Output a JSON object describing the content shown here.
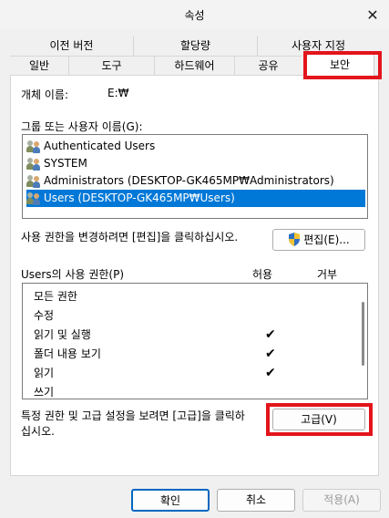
{
  "window": {
    "title": "속성",
    "close_glyph": "✕"
  },
  "tabs": {
    "row1": [
      "이전 버전",
      "할당량",
      "사용자 지정"
    ],
    "row2": [
      "일반",
      "도구",
      "하드웨어",
      "공유",
      "보안"
    ]
  },
  "object_name": {
    "label": "개체 이름:",
    "value": "E:₩"
  },
  "groups": {
    "label": "그룹 또는 사용자 이름(G):",
    "items": [
      "Authenticated Users",
      "SYSTEM",
      "Administrators (DESKTOP-GK465MP₩Administrators)",
      "Users (DESKTOP-GK465MP₩Users)"
    ],
    "selected_index": 3
  },
  "edit": {
    "hint": "사용 권한을 변경하려면 [편집]을 클릭하십시오.",
    "button": "편집(E)..."
  },
  "permissions": {
    "label": "Users의 사용 권한(P)",
    "allow_header": "허용",
    "deny_header": "거부",
    "rows": [
      {
        "name": "모든 권한",
        "allow": false
      },
      {
        "name": "수정",
        "allow": false
      },
      {
        "name": "읽기 및 실행",
        "allow": true
      },
      {
        "name": "폴더 내용 보기",
        "allow": true
      },
      {
        "name": "읽기",
        "allow": true
      },
      {
        "name": "쓰기",
        "allow": false
      }
    ],
    "check_glyph": "✔"
  },
  "advanced": {
    "hint_line1": "특정 권한 및 고급 설정을 보려면 [고급]을 클릭하",
    "hint_line2": "십시오.",
    "button": "고급(V)"
  },
  "footer": {
    "ok": "확인",
    "cancel": "취소",
    "apply": "적용(A)"
  },
  "colors": {
    "highlight": "#e3141b",
    "selection": "#0078d7"
  }
}
